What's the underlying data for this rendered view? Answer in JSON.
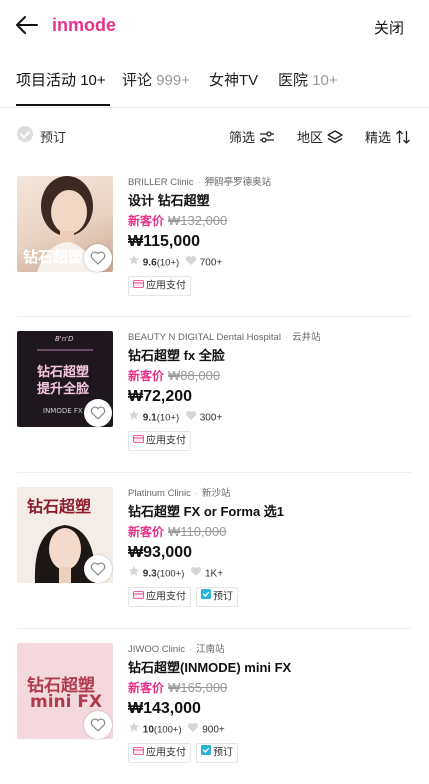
{
  "header": {
    "title": "inmode",
    "close_label": "关闭"
  },
  "tabs": [
    {
      "label": "项目活动",
      "count": "10+"
    },
    {
      "label": "评论",
      "count": "999+"
    },
    {
      "label": "女神TV",
      "count": ""
    },
    {
      "label": "医院",
      "count": "10+"
    }
  ],
  "filters": {
    "reserve_label": "预订",
    "sort_label": "筛选",
    "region_label": "地区",
    "select_label": "精选"
  },
  "colors": {
    "accent": "#e8338b",
    "reserve_badge": "#29b6d6"
  },
  "items": [
    {
      "clinic": "BRILLER Clinic",
      "station": "狎鸥亭罗德奥站",
      "name": "设计 钻石超塑",
      "new_label": "新客价",
      "old_price": "₩132,000",
      "price": "₩115,000",
      "rating": "9.6",
      "reviews": "(10+)",
      "likes": "700+",
      "badges": [
        "应用支付"
      ],
      "thumb_text": "钻石超塑"
    },
    {
      "clinic": "BEAUTY N DIGITAL Dental Hospital",
      "station": "云井站",
      "name": "钻石超塑 fx 全脸",
      "new_label": "新客价",
      "old_price": "₩88,000",
      "price": "₩72,200",
      "rating": "9.1",
      "reviews": "(10+)",
      "likes": "300+",
      "badges": [
        "应用支付"
      ],
      "thumb_text": "钻石超塑",
      "thumb_text2": "提升全脸",
      "thumb_logo": "B'n'D",
      "thumb_footer": "INMODE FX"
    },
    {
      "clinic": "Platinum Clinic",
      "station": "新沙站",
      "name": "钻石超塑 FX or Forma 选1",
      "new_label": "新客价",
      "old_price": "₩110,000",
      "price": "₩93,000",
      "rating": "9.3",
      "reviews": "(100+)",
      "likes": "1K+",
      "badges": [
        "应用支付",
        "预订"
      ],
      "thumb_text": "钻石超塑"
    },
    {
      "clinic": "JIWOO Clinic",
      "station": "江南站",
      "name": "钻石超塑(INMODE) mini FX",
      "new_label": "新客价",
      "old_price": "₩165,000",
      "price": "₩143,000",
      "rating": "10",
      "reviews": "(100+)",
      "likes": "900+",
      "badges": [
        "应用支付",
        "预订"
      ],
      "thumb_text": "钻石超塑",
      "thumb_text2": "mini FX"
    }
  ]
}
